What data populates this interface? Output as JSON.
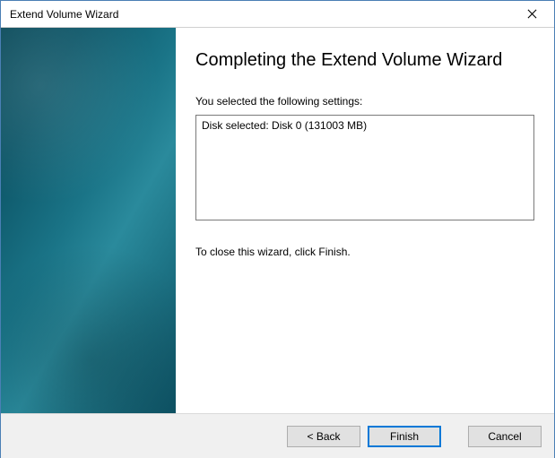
{
  "window": {
    "title": "Extend Volume Wizard"
  },
  "main": {
    "heading": "Completing the Extend Volume Wizard",
    "intro": "You selected the following settings:",
    "settings": [
      "Disk selected: Disk 0 (131003 MB)"
    ],
    "closing": "To close this wizard, click Finish."
  },
  "buttons": {
    "back": "< Back",
    "finish": "Finish",
    "cancel": "Cancel"
  }
}
